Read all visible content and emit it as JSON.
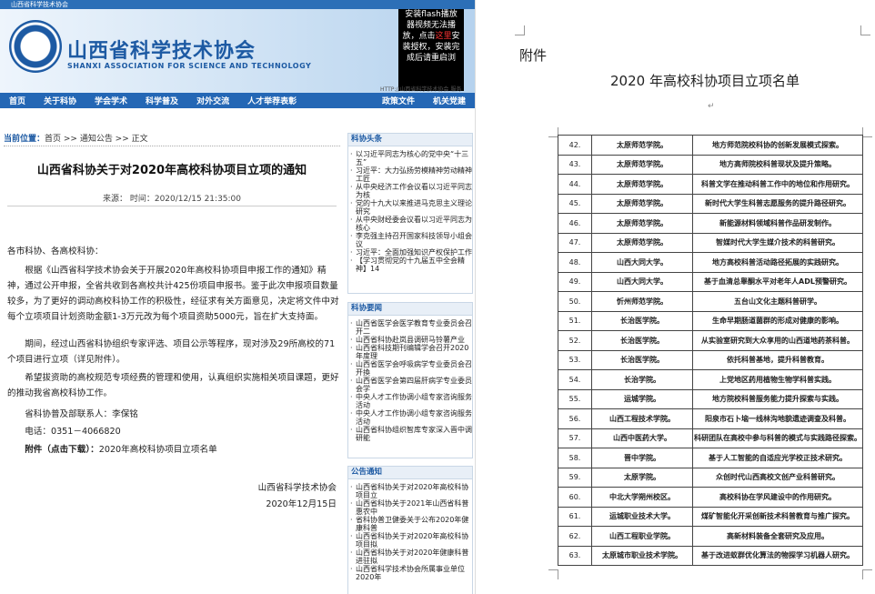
{
  "site": {
    "topbar": "山西省科学技术协会",
    "logo_text": "中国科学技术协会",
    "title": "山西省科学技术协会",
    "subtitle": "SHANXI ASSOCIATION FOR SCIENCE AND TECHNOLOGY",
    "flash_line1": "安装flash播放器视频无法播放，点击",
    "flash_link": "这里",
    "flash_line2": "安装授权，安装完成后请重启浏",
    "flash_url": "HTTP://山西省科学技术协会 服务",
    "nav": [
      "首页",
      "关于科协",
      "学会学术",
      "科学普及",
      "对外交流",
      "人才举荐表彰",
      "政策文件",
      "机关党建"
    ]
  },
  "breadcrumb": {
    "label": "当前位置：",
    "path": "首页 >> 通知公告 >> 正文"
  },
  "article": {
    "title": "山西省科协关于对2020年高校科协项目立项的通知",
    "meta": "来源：  时间：2020/12/15 21:35:00",
    "greeting": "各市科协、各高校科协：",
    "p1": "根据《山西省科学技术协会关于开展2020年高校科协项目申报工作的通知》精神，通过公开申报，全省共收到各高校共计425份项目申报书。鉴于此次申报项目数量较多，为了更好的调动高校科协工作的积极性，经征求有关方面意见，决定将文件中对每个立项项目计划资助金额1-3万元改为每个项目资助5000元，旨在扩大支持面。",
    "p2": "期间，经过山西省科协组织专家评选、项目公示等程序，现对涉及29所高校的71个项目进行立项（详见附件）。",
    "p3": "希望拔资助的高校规范专项经费的管理和使用，认真组织实施相关项目课题，更好的推动我省高校科协工作。",
    "contact": "省科协普及部联系人：李保铭",
    "phone": "电话：0351－4066820",
    "attach_label": "附件（点击下载）：",
    "attach_name": "2020年高校科协项目立项名单",
    "sign_org": "山西省科学技术协会",
    "sign_date": "2020年12月15日"
  },
  "sidebar": {
    "headline_title": "科协头条",
    "headlines": [
      "以习近平同志为核心的党中央“十三五”",
      "习近平：大力弘扬劳模精神劳动精神工匠",
      "从中央经济工作会议看以习近平同志为核",
      "党的十九大以来推进马克思主义理论研究",
      "从中央财经委会议看以习近平同志为核心",
      "李克强主持召开国家科技领导小组会议",
      "习近平：全面加强知识产权保护工作",
      "【学习贯彻党的十九届五中全会精神】14"
    ],
    "news_title": "科协要闻",
    "news": [
      "山西省医学会医学教育专业委员会召开二",
      "山西省科协赴岚县调研马铃薯产业",
      "山西省科技期刊编辑学会召开2020年度理",
      "山西省医学会呼吸病学专业委员会召开換",
      "山西省医学会第四届肝病学专业委员会学",
      "中央人才工作协调小组专家咨询服务活动",
      "中央人才工作协调小组专家咨询服务活动",
      "山西省科协组织智库专家深入晋中调研能"
    ],
    "notice_title": "公告通知",
    "notices": [
      "山西省科协关于对2020年高校科协项目立",
      "山西省科协关于2021年山西省科普惠农中",
      "省科协普卫健委关于公布2020年健康科普",
      "山西省科协关于对2020年高校科协项目拟",
      "山西省科协关于对2020年健康科普进驻拟",
      "山西省科学技术协会所属事业单位2020年"
    ]
  },
  "document": {
    "attach_label": "附件",
    "title": "2020 年高校科协项目立项名单",
    "rows": [
      {
        "no": "42.",
        "unit": "太原师范学院。",
        "project": "地方师范院校科协的创新发展模式探索。"
      },
      {
        "no": "43.",
        "unit": "太原师范学院。",
        "project": "地方高师院校科普现状及提升策略。"
      },
      {
        "no": "44.",
        "unit": "太原师范学院。",
        "project": "科普文学在推动科普工作中的地位和作用研究。"
      },
      {
        "no": "45.",
        "unit": "太原师范学院。",
        "project": "新时代大学生科普志愿服务的提升路径研究。"
      },
      {
        "no": "46.",
        "unit": "太原师范学院。",
        "project": "新能源材料领域科普作品研发制作。"
      },
      {
        "no": "47.",
        "unit": "太原师范学院。",
        "project": "智媒时代大学生媒介技术的科普研究。"
      },
      {
        "no": "48.",
        "unit": "山西大同大学。",
        "project": "地方高校科普活动路径拓展的实践研究。"
      },
      {
        "no": "49.",
        "unit": "山西大同大学。",
        "project": "基于血清总睾酮水平对老年人ADL预警研究。"
      },
      {
        "no": "50.",
        "unit": "忻州师范学院。",
        "project": "五台山文化主题科普研学。"
      },
      {
        "no": "51.",
        "unit": "长治医学院。",
        "project": "生命早期肠道菌群的形成对健康的影响。"
      },
      {
        "no": "52.",
        "unit": "长治医学院。",
        "project": "从实验室研究到大众享用的山西道地药茶科普。"
      },
      {
        "no": "53.",
        "unit": "长治医学院。",
        "project": "依托科普基地，提升科普教育。"
      },
      {
        "no": "54.",
        "unit": "长治学院。",
        "project": "上党地区药用植物生物学科普实践。"
      },
      {
        "no": "55.",
        "unit": "运城学院。",
        "project": "地方院校科普服务能力提升探索与实践。"
      },
      {
        "no": "56.",
        "unit": "山西工程技术学院。",
        "project": "阳泉市石卜垴一线林沟地貌遗迹调查及科普。"
      },
      {
        "no": "57.",
        "unit": "山西中医药大学。",
        "project": "科研团队在高校中参与科普的模式与实践路径探索。"
      },
      {
        "no": "58.",
        "unit": "晋中学院。",
        "project": "基于人工智能的自适应光学校正技术研究。"
      },
      {
        "no": "59.",
        "unit": "太原学院。",
        "project": "众创时代山西高校文创产业科普研究。"
      },
      {
        "no": "60.",
        "unit": "中北大学朔州校区。",
        "project": "高校科协在学风建设中的作用研究。"
      },
      {
        "no": "61.",
        "unit": "运城职业技术大学。",
        "project": "煤矿智能化开采创新技术科普教育与推广探究。"
      },
      {
        "no": "62.",
        "unit": "山西工程职业学院。",
        "project": "高新材料装备全套研究及应用。"
      },
      {
        "no": "63.",
        "unit": "太原城市职业技术学院。",
        "project": "基于改进蚁群优化算法的物探学习机器人研究。"
      }
    ]
  }
}
